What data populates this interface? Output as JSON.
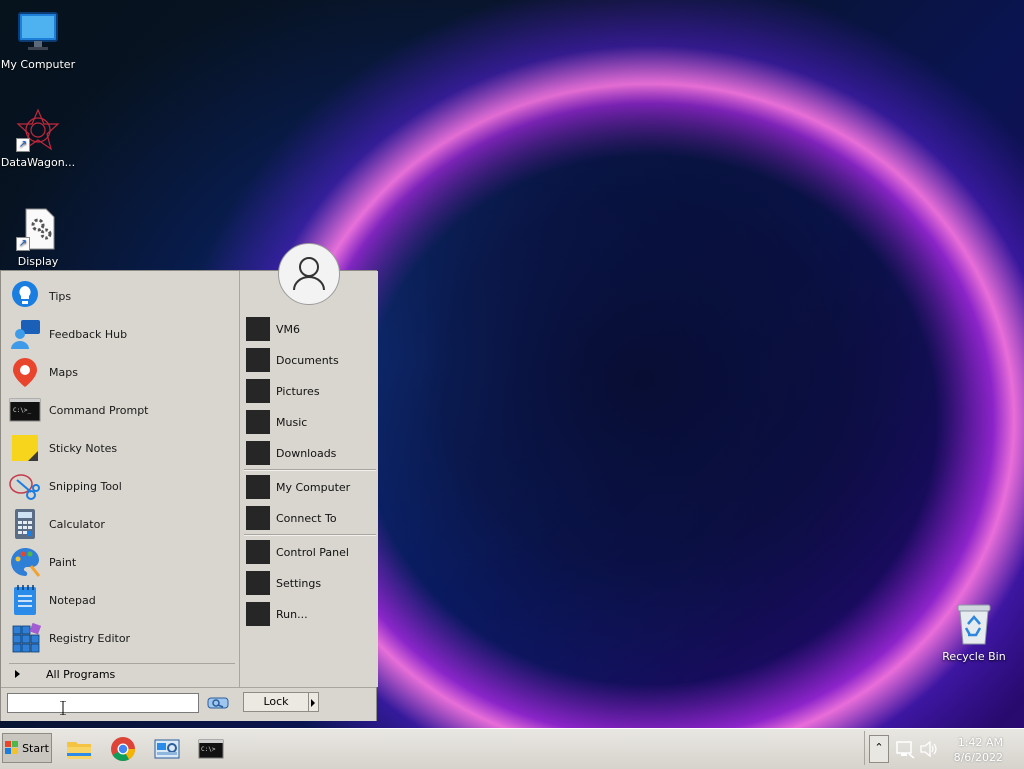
{
  "desktop": {
    "icons": [
      {
        "label": "My Computer"
      },
      {
        "label": "DataWagon..."
      },
      {
        "label": "Display"
      },
      {
        "label": "Recycle Bin"
      }
    ]
  },
  "start_menu": {
    "programs": [
      {
        "label": "Tips",
        "icon": "lightbulb-icon"
      },
      {
        "label": "Feedback Hub",
        "icon": "feedback-icon"
      },
      {
        "label": "Maps",
        "icon": "map-pin-icon"
      },
      {
        "label": "Command Prompt",
        "icon": "terminal-icon"
      },
      {
        "label": "Sticky Notes",
        "icon": "sticky-note-icon"
      },
      {
        "label": "Snipping Tool",
        "icon": "scissors-icon"
      },
      {
        "label": "Calculator",
        "icon": "calculator-icon"
      },
      {
        "label": "Paint",
        "icon": "palette-icon"
      },
      {
        "label": "Notepad",
        "icon": "notepad-icon"
      },
      {
        "label": "Registry Editor",
        "icon": "registry-icon"
      }
    ],
    "all_programs_label": "All Programs",
    "places": [
      {
        "label": "VM6"
      },
      {
        "label": "Documents"
      },
      {
        "label": "Pictures"
      },
      {
        "label": "Music"
      },
      {
        "label": "Downloads"
      },
      {
        "label": "My Computer"
      },
      {
        "label": "Connect To"
      },
      {
        "label": "Control Panel"
      },
      {
        "label": "Settings"
      },
      {
        "label": "Run..."
      }
    ],
    "search_value": "",
    "lock_label": "Lock"
  },
  "taskbar": {
    "start_label": "Start",
    "apps": [
      "file-explorer-icon",
      "chrome-icon",
      "control-panel-icon",
      "terminal-icon"
    ],
    "clock_time": "1:42 AM",
    "clock_date": "8/6/2022"
  },
  "colors": {
    "menu_bg": "#d9d6cf",
    "place_square": "#262626",
    "taskbar_bg": "#e9e7e2"
  }
}
